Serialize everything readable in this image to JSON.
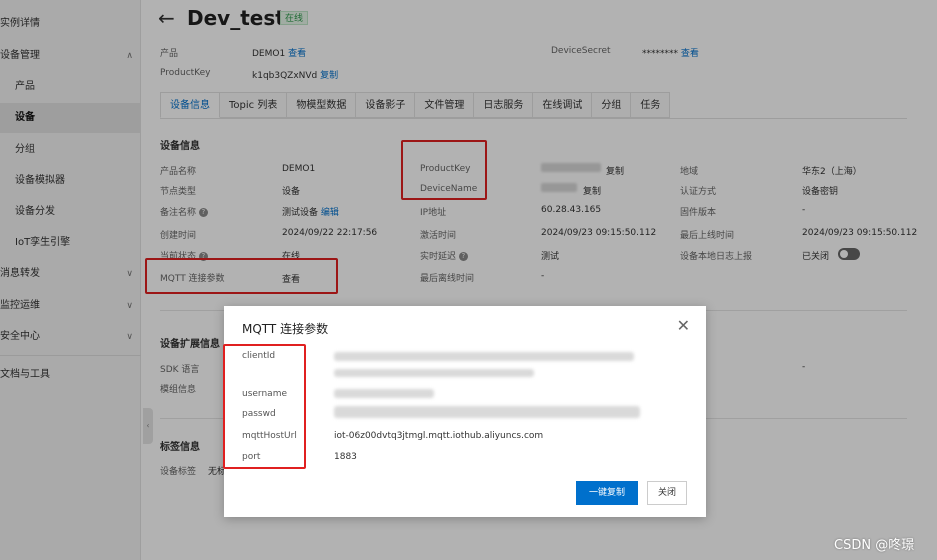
{
  "sidebar": {
    "items": [
      {
        "label": "实例详情",
        "chevron": ""
      },
      {
        "label": "设备管理",
        "chevron": "∧"
      },
      {
        "label": "产品",
        "chevron": ""
      },
      {
        "label": "设备",
        "chevron": ""
      },
      {
        "label": "分组",
        "chevron": ""
      },
      {
        "label": "设备模拟器",
        "chevron": ""
      },
      {
        "label": "设备分发",
        "chevron": ""
      },
      {
        "label": "IoT孪生引擎",
        "chevron": ""
      },
      {
        "label": "消息转发",
        "chevron": "∨"
      },
      {
        "label": "监控运维",
        "chevron": "∨"
      },
      {
        "label": "安全中心",
        "chevron": "∨"
      },
      {
        "label": "文档与工具",
        "chevron": ""
      }
    ]
  },
  "header": {
    "title": "Dev_test",
    "status": "在线",
    "product_label": "产品",
    "product_value": "DEMO1",
    "product_link": "查看",
    "productkey_label": "ProductKey",
    "productkey_value": "k1qb3QZxNVd",
    "productkey_link": "复制",
    "secret_label": "DeviceSecret",
    "secret_value": "********",
    "secret_link": "查看"
  },
  "tabs": [
    "设备信息",
    "Topic 列表",
    "物模型数据",
    "设备影子",
    "文件管理",
    "日志服务",
    "在线调试",
    "分组",
    "任务"
  ],
  "device_info": {
    "title": "设备信息",
    "col1": {
      "product_name_label": "产品名称",
      "product_name": "DEMO1",
      "node_type_label": "节点类型",
      "node_type": "设备",
      "remark_label": "备注名称",
      "remark": "测试设备",
      "remark_link": "编辑",
      "created_label": "创建时间",
      "created": "2024/09/22 22:17:56",
      "state_label": "当前状态",
      "state": "在线",
      "mqtt_label": "MQTT 连接参数",
      "mqtt_link": "查看"
    },
    "col2": {
      "productkey_label": "ProductKey",
      "productkey_link": "复制",
      "devicename_label": "DeviceName",
      "devicename_link": "复制",
      "ip_label": "IP地址",
      "ip": "60.28.43.165",
      "activated_label": "激活时间",
      "activated": "2024/09/23 09:15:50.112",
      "latency_label": "实时延迟",
      "latency_link": "测试",
      "last_offline_label": "最后离线时间",
      "last_offline": "-"
    },
    "col3": {
      "region_label": "地域",
      "region": "华东2（上海）",
      "auth_label": "认证方式",
      "auth": "设备密钥",
      "firmware_label": "固件版本",
      "firmware": "-",
      "last_online_label": "最后上线时间",
      "last_online": "2024/09/23 09:15:50.112",
      "local_log_label": "设备本地日志上报",
      "local_log": "已关闭"
    }
  },
  "ext_info": {
    "title": "设备扩展信息",
    "sdk_label": "SDK 语言",
    "module_label": "模组信息",
    "right_value": "-"
  },
  "tag_info": {
    "title": "标签信息",
    "tag_label": "设备标签",
    "tag_value": "无标"
  },
  "modal": {
    "title": "MQTT 连接参数",
    "clientid_label": "clientId",
    "username_label": "username",
    "passwd_label": "passwd",
    "host_label": "mqttHostUrl",
    "host_value": "iot-06z00dvtq3jtmgl.mqtt.iothub.aliyuncs.com",
    "port_label": "port",
    "port_value": "1883",
    "copy_button": "一键复制",
    "close_button": "关闭"
  },
  "watermark": "CSDN @咚璟",
  "colors": {
    "accent": "#0070cc",
    "annotation": "#e02020",
    "online": "#2e9a4c"
  }
}
